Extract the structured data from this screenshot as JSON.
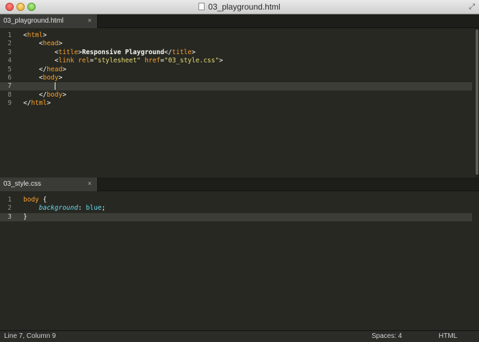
{
  "window": {
    "title": "03_playground.html"
  },
  "panes": [
    {
      "tab": {
        "label": "03_playground.html",
        "close": "×"
      },
      "active_line": 7,
      "lines": [
        {
          "n": "1",
          "tokens": [
            [
              "punct",
              "<"
            ],
            [
              "tag",
              "html"
            ],
            [
              "punct",
              ">"
            ]
          ]
        },
        {
          "n": "2",
          "tokens": [
            [
              "punct",
              "    <"
            ],
            [
              "tag",
              "head"
            ],
            [
              "punct",
              ">"
            ]
          ]
        },
        {
          "n": "3",
          "tokens": [
            [
              "punct",
              "        <"
            ],
            [
              "tag",
              "title"
            ],
            [
              "punct",
              ">"
            ],
            [
              "text",
              "Responsive Playground"
            ],
            [
              "punct",
              "</"
            ],
            [
              "tag",
              "title"
            ],
            [
              "punct",
              ">"
            ]
          ]
        },
        {
          "n": "4",
          "tokens": [
            [
              "punct",
              "        <"
            ],
            [
              "tag",
              "link"
            ],
            [
              "punct",
              " "
            ],
            [
              "attr",
              "rel"
            ],
            [
              "punct",
              "="
            ],
            [
              "str",
              "\"stylesheet\""
            ],
            [
              "punct",
              " "
            ],
            [
              "attr",
              "href"
            ],
            [
              "punct",
              "="
            ],
            [
              "str",
              "\"03_style.css\""
            ],
            [
              "punct",
              ">"
            ]
          ]
        },
        {
          "n": "5",
          "tokens": [
            [
              "punct",
              "    </"
            ],
            [
              "tag",
              "head"
            ],
            [
              "punct",
              ">"
            ]
          ]
        },
        {
          "n": "6",
          "tokens": [
            [
              "punct",
              "    <"
            ],
            [
              "tag",
              "body"
            ],
            [
              "punct",
              ">"
            ]
          ]
        },
        {
          "n": "7",
          "tokens": [
            [
              "punct",
              "        "
            ],
            [
              "caret",
              ""
            ]
          ]
        },
        {
          "n": "8",
          "tokens": [
            [
              "punct",
              "    </"
            ],
            [
              "tag",
              "body"
            ],
            [
              "punct",
              ">"
            ]
          ]
        },
        {
          "n": "9",
          "tokens": [
            [
              "punct",
              "</"
            ],
            [
              "tag",
              "html"
            ],
            [
              "punct",
              ">"
            ]
          ]
        }
      ]
    },
    {
      "tab": {
        "label": "03_style.css",
        "close": "×"
      },
      "active_line": 3,
      "lines": [
        {
          "n": "1",
          "tokens": [
            [
              "sel",
              "body"
            ],
            [
              "punct",
              " {"
            ]
          ]
        },
        {
          "n": "2",
          "tokens": [
            [
              "punct",
              "    "
            ],
            [
              "prop",
              "background"
            ],
            [
              "punct",
              ": "
            ],
            [
              "val",
              "blue"
            ],
            [
              "punct",
              ";"
            ]
          ]
        },
        {
          "n": "3",
          "tokens": [
            [
              "punct",
              "}"
            ]
          ]
        }
      ]
    }
  ],
  "statusbar": {
    "position": "Line 7, Column 9",
    "spaces": "Spaces: 4",
    "syntax": "HTML"
  },
  "icons": {
    "file": "document-icon",
    "fullscreen": "fullscreen-arrows-icon",
    "close": "close-icon"
  }
}
